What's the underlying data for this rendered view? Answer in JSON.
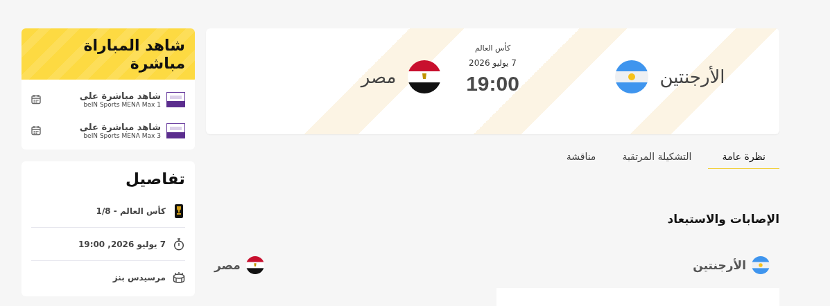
{
  "match": {
    "competition": "كأس العالم",
    "date": "7 يوليو 2026",
    "time": "19:00",
    "home": {
      "name": "الأرجنتين",
      "kind": "argentina"
    },
    "away": {
      "name": "مصر",
      "kind": "egypt"
    }
  },
  "tabs": [
    {
      "label": "نظرة عامة",
      "selected": true
    },
    {
      "label": "التشكيلة المرتقبة",
      "selected": false
    },
    {
      "label": "مناقشة",
      "selected": false
    }
  ],
  "injuries": {
    "title": "الإصابات والاستبعاد",
    "home": {
      "name": "الأرجنتين",
      "kind": "argentina"
    },
    "away": {
      "name": "مصر",
      "kind": "egypt"
    }
  },
  "watch_live": {
    "title": "شاهد المباراة مباشرة",
    "channels": [
      {
        "label": "شاهد مباشرة على",
        "channel": "beIN Sports MENA Max 1"
      },
      {
        "label": "شاهد مباشرة على",
        "channel": "beIN Sports MENA Max 3"
      }
    ]
  },
  "details": {
    "title": "تفاصيل",
    "items": [
      {
        "kind": "competition",
        "text": "كأس العالم - 1/8"
      },
      {
        "kind": "datetime",
        "text": "7 يوليو 2026, 19:00"
      },
      {
        "kind": "venue",
        "text": "مرسيدس بنز"
      }
    ]
  }
}
